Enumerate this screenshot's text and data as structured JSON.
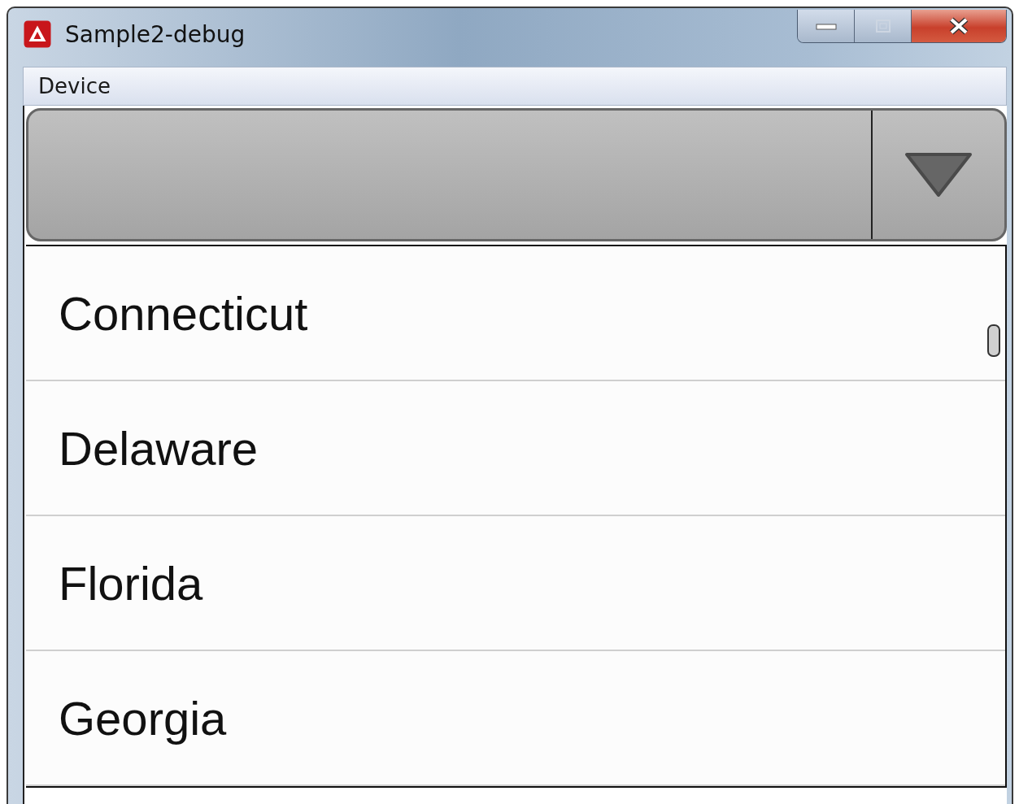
{
  "window": {
    "title": "Sample2-debug"
  },
  "menu": [
    {
      "label": "Device"
    }
  ],
  "list": {
    "items": [
      {
        "label": "Connecticut"
      },
      {
        "label": "Delaware"
      },
      {
        "label": "Florida"
      },
      {
        "label": "Georgia"
      }
    ]
  }
}
